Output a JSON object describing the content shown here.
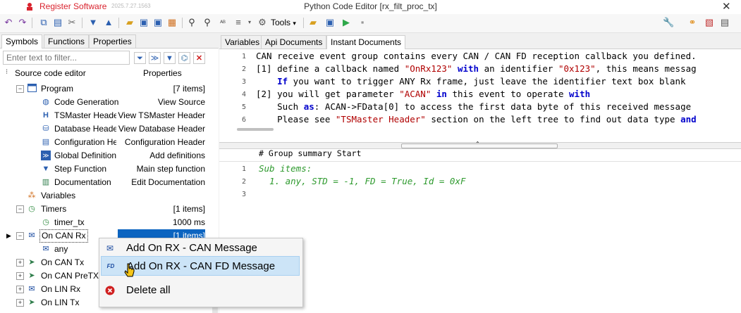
{
  "titlebar": {
    "app_name": "Register Software",
    "version": "2025.7.27.1563",
    "window_title": "Python Code Editor [rx_filt_proc_tx]",
    "close": "✕"
  },
  "toolbar": {
    "tools_label": "Tools",
    "tools_arrow": "▾"
  },
  "left_panel": {
    "tabs": [
      "Symbols",
      "Functions",
      "Properties"
    ],
    "filter_placeholder": "Enter text to filter...",
    "tree_header": {
      "col1": "Source code editor",
      "col2": "Properties"
    },
    "rows": [
      {
        "label": "Program",
        "value": "[7 items]"
      },
      {
        "label": "Code Generation",
        "value": "View Source"
      },
      {
        "label": "TSMaster Header",
        "value": "View TSMaster Header"
      },
      {
        "label": "Database Header",
        "value": "View Database Header"
      },
      {
        "label": "Configuration Header",
        "value": "Configuration Header"
      },
      {
        "label": "Global Definition",
        "value": "Add definitions"
      },
      {
        "label": "Step Function",
        "value": "Main step function"
      },
      {
        "label": "Documentation",
        "value": "Edit Documentation"
      },
      {
        "label": "Variables",
        "value": ""
      },
      {
        "label": "Timers",
        "value": "[1 items]"
      },
      {
        "label": "timer_tx",
        "value": "1000 ms"
      },
      {
        "label": "On CAN Rx",
        "value": "[1 items]"
      },
      {
        "label": "any",
        "value": ""
      },
      {
        "label": "On CAN Tx",
        "value": ""
      },
      {
        "label": "On CAN PreTX",
        "value": ""
      },
      {
        "label": "On LIN Rx",
        "value": ""
      },
      {
        "label": "On LIN Tx",
        "value": ""
      }
    ]
  },
  "right_panel": {
    "tabs": [
      "Variables",
      "Api Documents",
      "Instant Documents"
    ],
    "doc_lines": [
      {
        "n": "1"
      },
      {
        "n": "2"
      },
      {
        "n": "3"
      },
      {
        "n": "4"
      },
      {
        "n": "5"
      },
      {
        "n": "6"
      }
    ],
    "doc_text": {
      "l1": "CAN receive event group contains every CAN / CAN FD reception callback you defined.",
      "l2a": "[1] define a callback named ",
      "l2b": "\"OnRx123\"",
      "l2c": " with",
      "l2d": " an identifier ",
      "l2e": "\"0x123\"",
      "l2f": ", this means messag",
      "l3a": "    If",
      "l3b": " you want to trigger ANY Rx frame, just leave the identifier text box blank",
      "l4a": "[2] you will get parameter ",
      "l4b": "\"ACAN\"",
      "l4c": " in",
      "l4d": " this event to operate ",
      "l4e": "with",
      "l5a": "    Such ",
      "l5b": "as",
      "l5c": ": ACAN->FData[0] to access the first data byte of this received message",
      "l6a": "    Please see ",
      "l6b": "\"TSMaster Header\"",
      "l6c": " section on the left tree to find out data type ",
      "l6d": "and"
    },
    "summary_header": "# Group summary Start",
    "code_lines": [
      {
        "n": "1",
        "text": "Sub items:"
      },
      {
        "n": "2",
        "text": "  1. any, STD = -1, FD = True, Id = 0xF"
      },
      {
        "n": "3",
        "text": ""
      }
    ]
  },
  "context_menu": {
    "items": [
      {
        "label": "Add On RX - CAN Message"
      },
      {
        "label": "Add On RX - CAN FD Message"
      },
      {
        "label": "Delete all"
      }
    ],
    "fd_badge": "FD"
  },
  "colors": {
    "accent": "#0c64c0",
    "brand": "#d9232e",
    "highlight": "#cce4f7"
  }
}
